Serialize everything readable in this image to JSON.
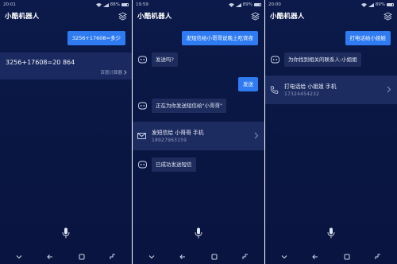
{
  "app": {
    "title": "小酷机器人"
  },
  "colors": {
    "background": "#0b1a4a",
    "user_bubble": "#2e7bf2",
    "bot_bubble": "#1d2c5d",
    "card": "#1c2b60"
  },
  "screens": [
    {
      "status_time": "20:01",
      "status_battery": "88%",
      "user_message": "3256+17608=多少",
      "answer": {
        "text": "3256+17608=20 864",
        "source_label": "百度计算器"
      }
    },
    {
      "status_time": "19:59",
      "status_battery": "89%",
      "user_message_1": "发短信给小哥哥说晚上吃宵夜",
      "bot_message_1": "发送吗?",
      "user_message_2": "发送",
      "bot_message_2": "正在为你发送短信给\"小哥哥\"",
      "sms_card": {
        "title": "发短信给  小哥哥  手机",
        "number": "18927963159"
      },
      "bot_message_3": "已成功发送短信"
    },
    {
      "status_time": "20:00",
      "status_battery": "89%",
      "user_message": "打电话给小姐姐",
      "bot_message": "为你找到相关的联系人:小姐姐",
      "call_card": {
        "title": "打电话给  小姐姐  手机",
        "number": "17324454232"
      }
    }
  ],
  "icons": [
    "layers-icon",
    "robot-icon",
    "envelope-icon",
    "phone-icon",
    "chevron-right-icon",
    "mic-icon",
    "nav-down-icon",
    "nav-back-icon",
    "nav-home-icon",
    "nav-recent-icon"
  ]
}
